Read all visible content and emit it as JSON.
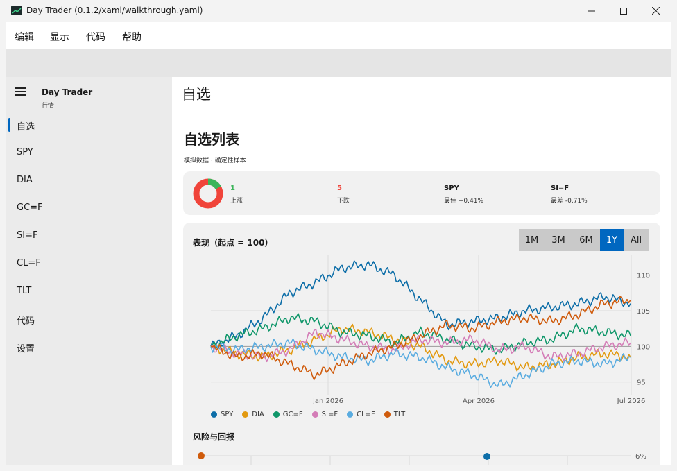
{
  "window": {
    "title": "Day Trader (0.1.2/xaml/walkthrough.yaml)",
    "minimize_icon": "minimize-icon",
    "maximize_icon": "maximize-icon",
    "close_icon": "close-icon"
  },
  "menu": [
    "编辑",
    "显示",
    "代码",
    "帮助"
  ],
  "sidebar": {
    "app_name": "Day Trader",
    "app_subtitle": "行情",
    "menu_icon": "hamburger-icon",
    "items": [
      "自选",
      "SPY",
      "DIA",
      "GC=F",
      "SI=F",
      "CL=F",
      "TLT",
      "代码",
      "设置"
    ],
    "selected": "自选"
  },
  "page": {
    "title": "自选",
    "heading": "自选列表",
    "subheading": "模拟数据 · 确定性样本"
  },
  "summary": {
    "up_count": "1",
    "up_label": "上涨",
    "down_count": "5",
    "down_label": "下跌",
    "best_symbol": "SPY",
    "best_label": "最佳 +0.41%",
    "worst_symbol": "SI=F",
    "worst_label": "最差 -0.71%",
    "donut": {
      "up": 1,
      "down": 5,
      "up_color": "#3cb55a",
      "down_color": "#f0443a"
    }
  },
  "performance": {
    "title": "表现（起点 = 100）",
    "ranges": [
      "1M",
      "3M",
      "6M",
      "1Y",
      "All"
    ],
    "active_range": "1Y"
  },
  "risk": {
    "title": "风险与回报",
    "y_tick": "6%"
  },
  "chart_data": {
    "type": "line",
    "title": "表现（起点 = 100）",
    "x_ticks": [
      "Jan 2026",
      "Apr 2026",
      "Jul 2026"
    ],
    "y_ticks": [
      "95",
      "100",
      "105",
      "110"
    ],
    "ylim": [
      94,
      112
    ],
    "grid": true,
    "legend_position": "bottom",
    "series": [
      {
        "name": "SPY",
        "color": "#0d6ea8",
        "values": [
          100,
          101.5,
          104,
          107.5,
          109,
          111,
          111.5,
          110,
          106.5,
          103,
          103.5,
          104,
          105,
          105.5,
          106,
          107,
          106
        ]
      },
      {
        "name": "DIA",
        "color": "#e29a12",
        "values": [
          100,
          99,
          98.5,
          99.5,
          101,
          102.5,
          102,
          101,
          100,
          98,
          97.5,
          98,
          97,
          97.5,
          98.5,
          99,
          98.5
        ]
      },
      {
        "name": "GC=F",
        "color": "#10976a",
        "values": [
          100,
          101.5,
          102.5,
          104,
          103.5,
          102,
          101.5,
          100.5,
          102,
          101,
          100,
          99.5,
          100.5,
          101,
          102.5,
          102,
          101.5
        ]
      },
      {
        "name": "SI=F",
        "color": "#d47db7",
        "values": [
          100,
          99,
          98.5,
          99.5,
          102,
          101,
          100,
          99.5,
          101,
          100.5,
          101,
          99.5,
          100,
          98.5,
          99,
          100,
          100.5
        ]
      },
      {
        "name": "CL=F",
        "color": "#5aace0",
        "values": [
          100,
          99.5,
          100,
          100.5,
          99.5,
          98.5,
          98,
          99,
          98.5,
          97,
          96,
          94.5,
          96,
          97.5,
          98,
          97.5,
          98.5
        ]
      },
      {
        "name": "TLT",
        "color": "#cf5b0c",
        "values": [
          100,
          98.5,
          99,
          97.5,
          96,
          97.5,
          99,
          100,
          101.5,
          103,
          102.5,
          103.5,
          104,
          103.5,
          104.5,
          106,
          106.5
        ]
      }
    ]
  }
}
